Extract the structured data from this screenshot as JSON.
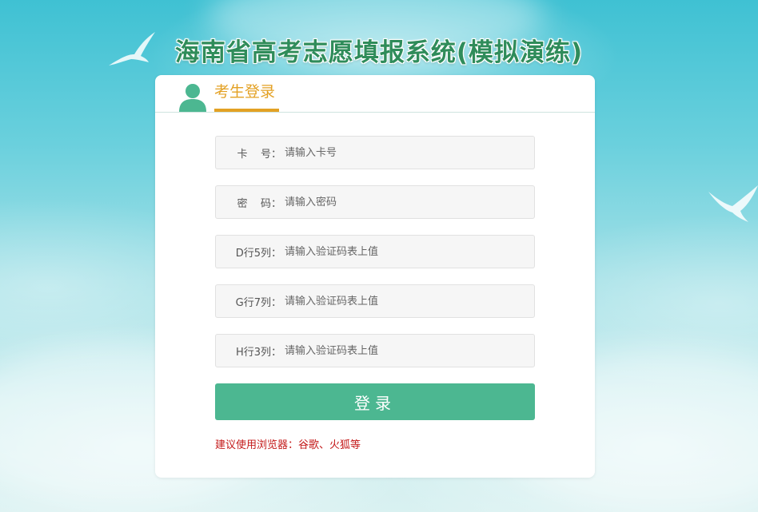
{
  "header": {
    "site_title": "海南省高考志愿填报系统(模拟演练)"
  },
  "panel": {
    "tab_label": "考生登录",
    "user_icon": "user-icon"
  },
  "form": {
    "fields": [
      {
        "label": "卡    号：",
        "placeholder": "请输入卡号"
      },
      {
        "label": "密    码：",
        "placeholder": "请输入密码"
      },
      {
        "label": "D行5列：",
        "placeholder": "请输入验证码表上值"
      },
      {
        "label": "G行7列：",
        "placeholder": "请输入验证码表上值"
      },
      {
        "label": "H行3列：",
        "placeholder": "请输入验证码表上值"
      }
    ],
    "login_label": "登录",
    "browser_tip": "建议使用浏览器：谷歌、火狐等"
  },
  "colors": {
    "title_green": "#2f8c5a",
    "tab_orange": "#e3a124",
    "button_green": "#4cb791",
    "tip_red": "#c41a1a"
  }
}
